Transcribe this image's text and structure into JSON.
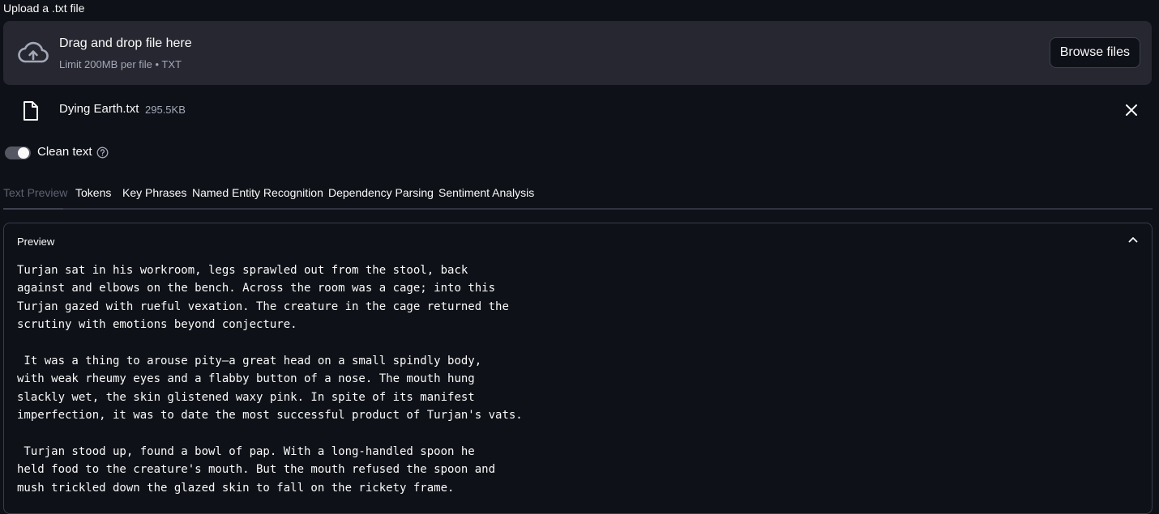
{
  "uploader": {
    "label": "Upload a .txt file",
    "dropzone_title": "Drag and drop file here",
    "dropzone_subtitle": "Limit 200MB per file • TXT",
    "browse_label": "Browse files",
    "icon": "cloud-upload-icon"
  },
  "file": {
    "name": "Dying Earth.txt",
    "size": "295.5KB",
    "icon": "file-icon",
    "remove_icon": "close-icon"
  },
  "toggle": {
    "label": "Clean text",
    "checked": true,
    "help_icon": "help-circle-icon"
  },
  "tabs": [
    {
      "label": "Text Preview",
      "active": true
    },
    {
      "label": "Tokens",
      "active": false
    },
    {
      "label": "Key Phrases",
      "active": false
    },
    {
      "label": "Named Entity Recognition",
      "active": false
    },
    {
      "label": "Dependency Parsing",
      "active": false
    },
    {
      "label": "Sentiment Analysis",
      "active": false
    }
  ],
  "preview": {
    "title": "Preview",
    "expanded": true,
    "text": "Turjan sat in his workroom, legs sprawled out from the stool, back\nagainst and elbows on the bench. Across the room was a cage; into this\nTurjan gazed with rueful vexation. The creature in the cage returned the\nscrutiny with emotions beyond conjecture.\n\n It was a thing to arouse pity—a great head on a small spindly body,\nwith weak rheumy eyes and a flabby button of a nose. The mouth hung\nslackly wet, the skin glistened waxy pink. In spite of its manifest\nimperfection, it was to date the most successful product of Turjan's vats.\n\n Turjan stood up, found a bowl of pap. With a long-handled spoon he\nheld food to the creature's mouth. But the mouth refused the spoon and\nmush trickled down the glazed skin to fall on the rickety frame."
  }
}
